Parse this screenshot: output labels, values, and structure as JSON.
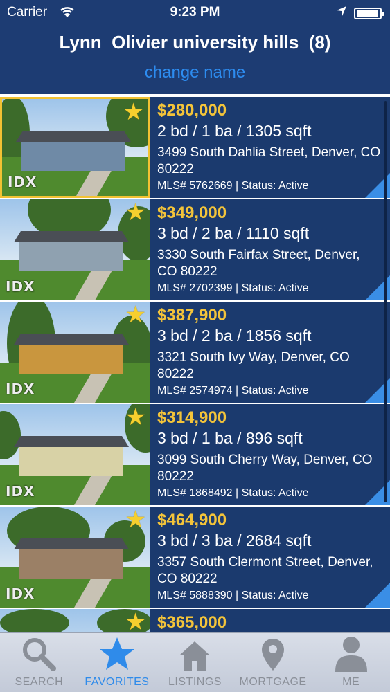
{
  "status_bar": {
    "carrier": "Carrier",
    "time": "9:23 PM"
  },
  "header": {
    "title": "Lynn  Olivier university hills  (8)",
    "change_name": "change name"
  },
  "listings": [
    {
      "price": "$280,000",
      "specs": "2 bd / 1 ba / 1305 sqft",
      "address": "3499 South Dahlia Street, Denver, CO 80222",
      "mls": "MLS# 5762669 | Status: Active",
      "favorite": true,
      "selected": true
    },
    {
      "price": "$349,000",
      "specs": "3 bd / 2 ba / 1110 sqft",
      "address": "3330 South Fairfax Street, Denver, CO 80222",
      "mls": "MLS# 2702399 | Status: Active",
      "favorite": true,
      "selected": false
    },
    {
      "price": "$387,900",
      "specs": "3 bd / 2 ba / 1856 sqft",
      "address": "3321 South Ivy Way, Denver, CO 80222",
      "mls": "MLS# 2574974 | Status: Active",
      "favorite": true,
      "selected": false
    },
    {
      "price": "$314,900",
      "specs": "3 bd / 1 ba / 896 sqft",
      "address": "3099 South Cherry Way, Denver, CO 80222",
      "mls": "MLS# 1868492 | Status: Active",
      "favorite": true,
      "selected": false
    },
    {
      "price": "$464,900",
      "specs": "3 bd / 3 ba / 2684 sqft",
      "address": "3357 South Clermont Street, Denver, CO 80222",
      "mls": "MLS# 5888390 | Status: Active",
      "favorite": true,
      "selected": false
    },
    {
      "price": "$365,000",
      "specs": "",
      "address": "",
      "mls": "",
      "favorite": true,
      "selected": false
    }
  ],
  "thumb_badge": "IDX",
  "tabs": [
    {
      "label": "SEARCH",
      "icon": "search-icon",
      "active": false
    },
    {
      "label": "FAVORITES",
      "icon": "star-icon",
      "active": true
    },
    {
      "label": "LISTINGS",
      "icon": "house-icon",
      "active": false
    },
    {
      "label": "MORTGAGE",
      "icon": "location-pin-icon",
      "active": false
    },
    {
      "label": "ME",
      "icon": "person-icon",
      "active": false
    }
  ],
  "colors": {
    "nav_bg": "#1d3c73",
    "row_bg": "#1b3a6e",
    "price": "#f3c43a",
    "link": "#2d8cf0",
    "tab_active": "#2f8bea",
    "selected_border": "#f2c233"
  }
}
